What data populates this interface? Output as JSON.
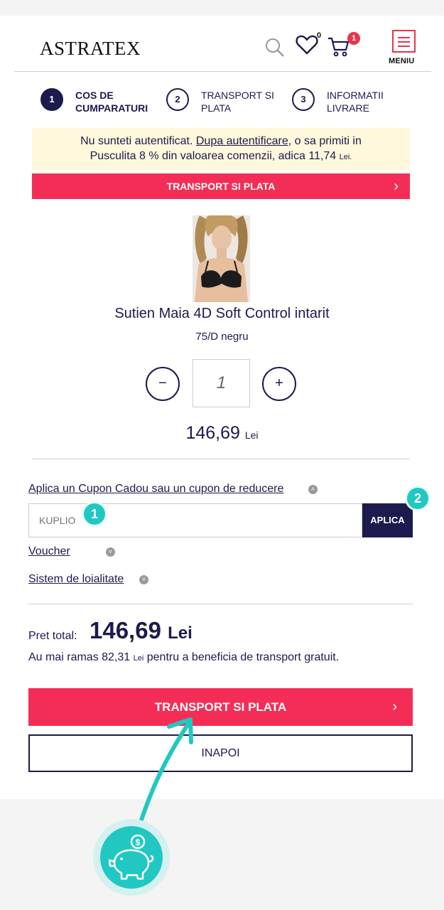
{
  "header": {
    "logo": "ASTRATEX",
    "wishlist_count": "0",
    "cart_count": "1",
    "menu_label": "MENIU"
  },
  "steps": [
    {
      "number": "1",
      "line1": "COS DE",
      "line2": "CUMPARATURI"
    },
    {
      "number": "2",
      "line1": "TRANSPORT SI",
      "line2": "PLATA"
    },
    {
      "number": "3",
      "line1": "INFORMATII",
      "line2": "LIVRARE"
    }
  ],
  "notice": {
    "line1_a": "Nu sunteti autentificat. ",
    "line1_link": "Dupa autentificare",
    "line1_b": ", o sa primiti in",
    "line2": "Pusculita 8 % din valoarea comenzii, adica 11,74 ",
    "line2_currency": "Lei."
  },
  "top_button": {
    "label": "TRANSPORT SI PLATA",
    "chevron": "›"
  },
  "product": {
    "name": "Sutien Maia 4D Soft Control intarit",
    "variant": "75/D negru",
    "quantity": "1",
    "minus": "−",
    "plus": "+",
    "price": "146,69",
    "currency": "Lei"
  },
  "coupon": {
    "link": "Aplica un Cupon Cadou sau un cupon de reducere",
    "placeholder": "KUPLIO",
    "apply_label": "APLICA",
    "badge_1": "1",
    "badge_2": "2"
  },
  "voucher_link": "Voucher",
  "loyalty_link": "Sistem de loialitate",
  "totals": {
    "label": "Pret total:",
    "value": "146,69",
    "currency": "Lei",
    "free_ship_a": "Au mai ramas 82,31 ",
    "free_ship_currency": "Lei",
    "free_ship_b": " pentru a beneficia de transport gratuit."
  },
  "main_button": {
    "label": "TRANSPORT SI PLATA",
    "chevron": "›"
  },
  "back_button": {
    "label": "INAPOI"
  },
  "colors": {
    "accent": "#f42d57",
    "navy": "#1d1a4d",
    "teal": "#21c8c2"
  }
}
